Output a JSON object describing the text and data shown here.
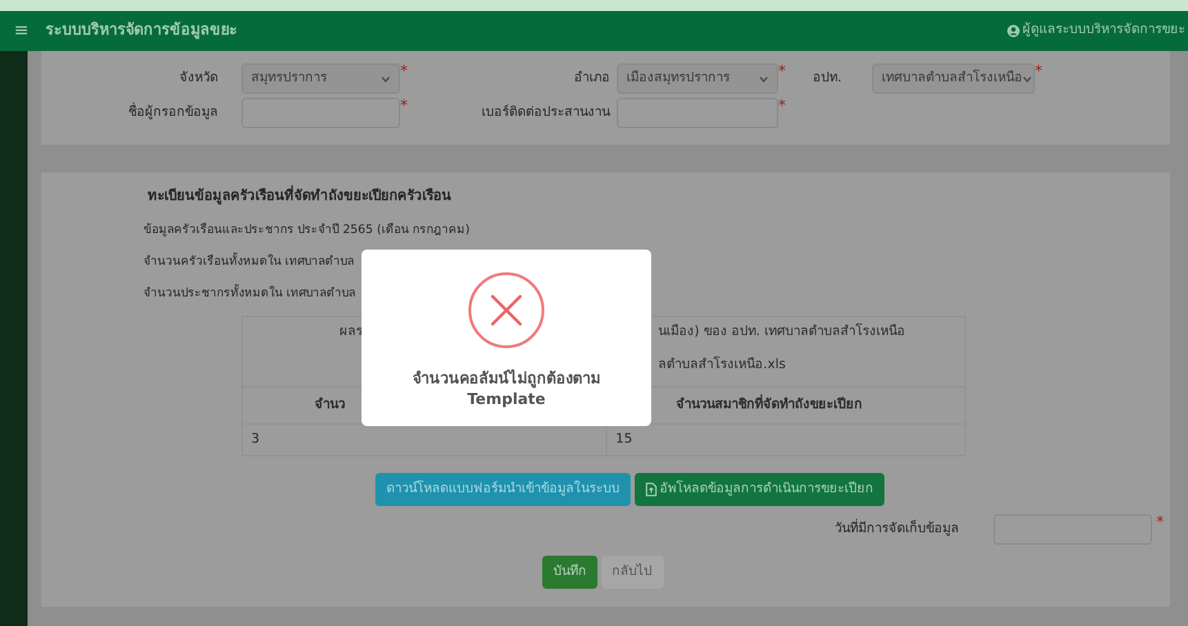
{
  "navbar": {
    "menu_icon": "≡",
    "title": "ระบบบริหารจัดการข้อมูลขยะ",
    "user": "ผู้ดูแลระบบบริหารจัดการขยะ"
  },
  "location_form": {
    "rows": [
      [
        {
          "label": "จังหวัด",
          "kind": "select",
          "value": "สมุทรปราการ",
          "required_mark": "*"
        },
        {
          "label": "อำเภอ",
          "kind": "select",
          "value": "เมืองสมุทรปราการ",
          "required_mark": "*"
        },
        {
          "label": "อปท.",
          "kind": "select",
          "value": "เทศบาลตำบลสำโรงเหนือ",
          "required_mark": "*"
        }
      ],
      [
        {
          "label": "ชื่อผู้กรอกข้อมูล",
          "kind": "input",
          "required_mark": "*"
        },
        {
          "label": "เบอร์ติดต่อประสานงาน",
          "kind": "input",
          "required_mark": "*"
        }
      ]
    ]
  },
  "register": {
    "title": "ทะเบียนข้อมูลครัวเรือนที่จัดทำถังขยะเปียกครัวเรือน",
    "lines": [
      "ข้อมูลครัวเรือนและประชากร ประจำปี 2565 (เดือน กรกฎาคม)",
      "จำนวนครัวเรือนทั้งหมดใน เทศบาลตำบล",
      "จำนวนประชากรทั้งหมดใน เทศบาลตำบล"
    ],
    "table": {
      "rows": [
        {
          "kind": "header",
          "cells": [
            [
              "ผลร"
            ],
            [
              "นเมือง) ของ อปท. เทศบาลตำบลสำโรงเหนือ",
              "ลตำบลสำโรงเหนือ.xls"
            ]
          ]
        },
        {
          "kind": "header",
          "cells": [
            [
              "จำนว"
            ],
            [
              "จำนวนสมาชิกที่จัดทำถังขยะเปียก"
            ]
          ]
        },
        {
          "kind": "data",
          "cells": [
            [
              "3"
            ],
            [
              "15"
            ]
          ]
        }
      ]
    },
    "buttons": [
      {
        "label": "ดาวน์โหลดแบบฟอร์มนำเข้าข้อมูลในระบบ",
        "kind": "info"
      },
      {
        "label": "อัพโหลดข้อมูลการดำเนินการขยะเปียก",
        "kind": "upload"
      }
    ],
    "date_field": {
      "label": "วันที่มีการจัดเก็บข้อมูล",
      "required_mark": "*"
    },
    "form_buttons": [
      {
        "label": "บันทึก",
        "kind": "primary"
      },
      {
        "label": "กลับไป",
        "kind": "secondary"
      }
    ]
  },
  "modal": {
    "message": "จำนวนคอลัมน์ไม่ถูกต้องตาม Template"
  }
}
